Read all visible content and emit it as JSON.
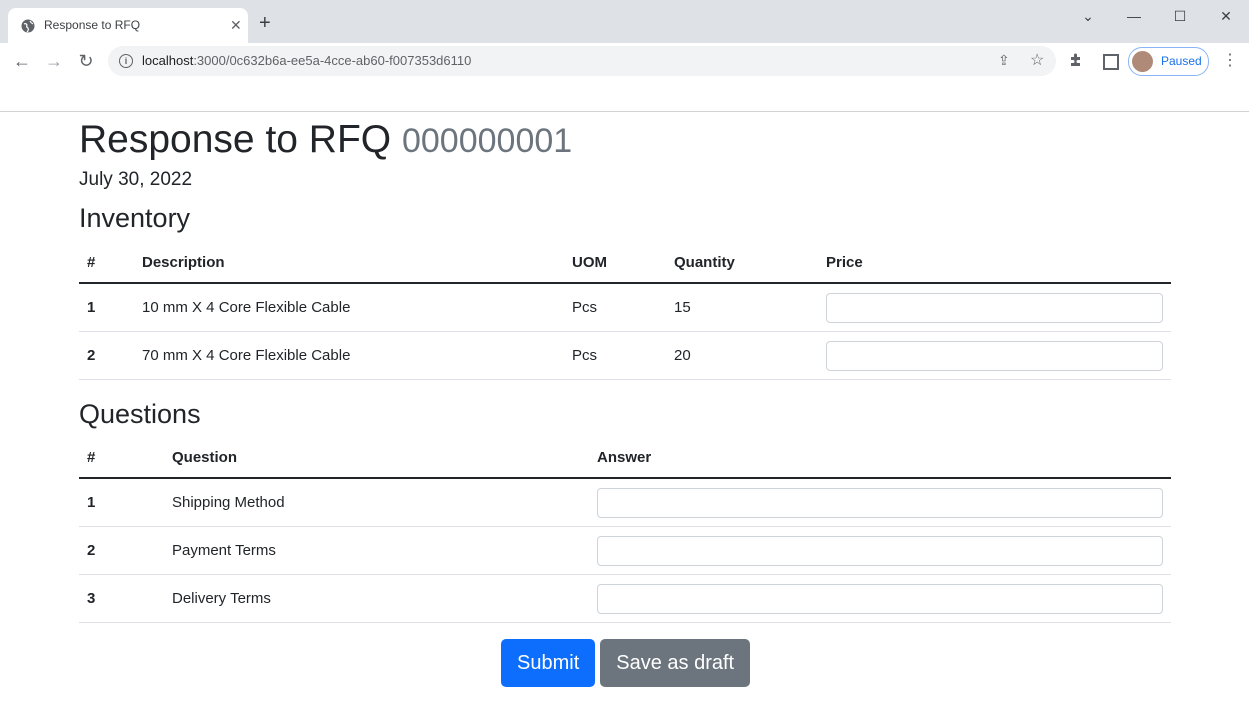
{
  "browser": {
    "tab_title": "Response to RFQ",
    "tab_close": "✕",
    "new_tab": "+",
    "url_host": "localhost",
    "url_rest": ":3000/0c632b6a-ee5a-4cce-ab60-f007353d6110",
    "profile_status": "Paused",
    "window_controls": {
      "minimize": "—",
      "maximize": "☐",
      "close": "✕",
      "tab_search": "⌄"
    }
  },
  "page": {
    "title": "Response to RFQ",
    "rfq_number": "000000001",
    "date": "July 30, 2022"
  },
  "inventory": {
    "heading": "Inventory",
    "columns": [
      "#",
      "Description",
      "UOM",
      "Quantity",
      "Price"
    ],
    "rows": [
      {
        "num": "1",
        "description": "10 mm X 4 Core Flexible Cable",
        "uom": "Pcs",
        "quantity": "15",
        "price": ""
      },
      {
        "num": "2",
        "description": "70 mm X 4 Core Flexible Cable",
        "uom": "Pcs",
        "quantity": "20",
        "price": ""
      }
    ]
  },
  "questions": {
    "heading": "Questions",
    "columns": [
      "#",
      "Question",
      "Answer"
    ],
    "rows": [
      {
        "num": "1",
        "question": "Shipping Method",
        "answer": ""
      },
      {
        "num": "2",
        "question": "Payment Terms",
        "answer": ""
      },
      {
        "num": "3",
        "question": "Delivery Terms",
        "answer": ""
      }
    ]
  },
  "actions": {
    "submit": "Submit",
    "save_draft": "Save as draft"
  },
  "colors": {
    "primary": "#0d6efd",
    "secondary": "#6c757d",
    "muted_text": "#6c757d"
  },
  "icons": [
    "globe-icon",
    "back-icon",
    "forward-icon",
    "reload-icon",
    "info-icon",
    "share-icon",
    "star-icon",
    "extensions-icon",
    "side-panel-icon",
    "avatar",
    "kebab-menu-icon"
  ]
}
